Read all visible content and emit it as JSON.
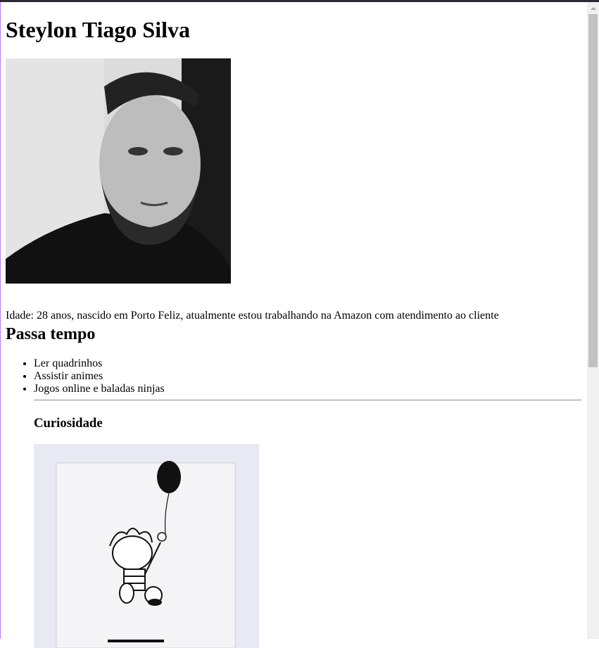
{
  "page": {
    "title": "Steylon Tiago Silva",
    "bio": "Idade: 28 anos, nascido em Porto Feliz, atualmente estou trabalhando na Amazon com atendimento ao cliente",
    "hobbies_heading": "Passa tempo",
    "hobbies": [
      "Ler quadrinhos",
      "Assistir animes",
      "Jogos online e baladas ninjas"
    ],
    "curiosity_heading": "Curiosidade"
  },
  "colors": {
    "background": "#ffffff",
    "text": "#000000",
    "topbar": "#2b2a33",
    "scrollbar_track": "#f0f0f0",
    "scrollbar_thumb": "#c1c1c1"
  }
}
